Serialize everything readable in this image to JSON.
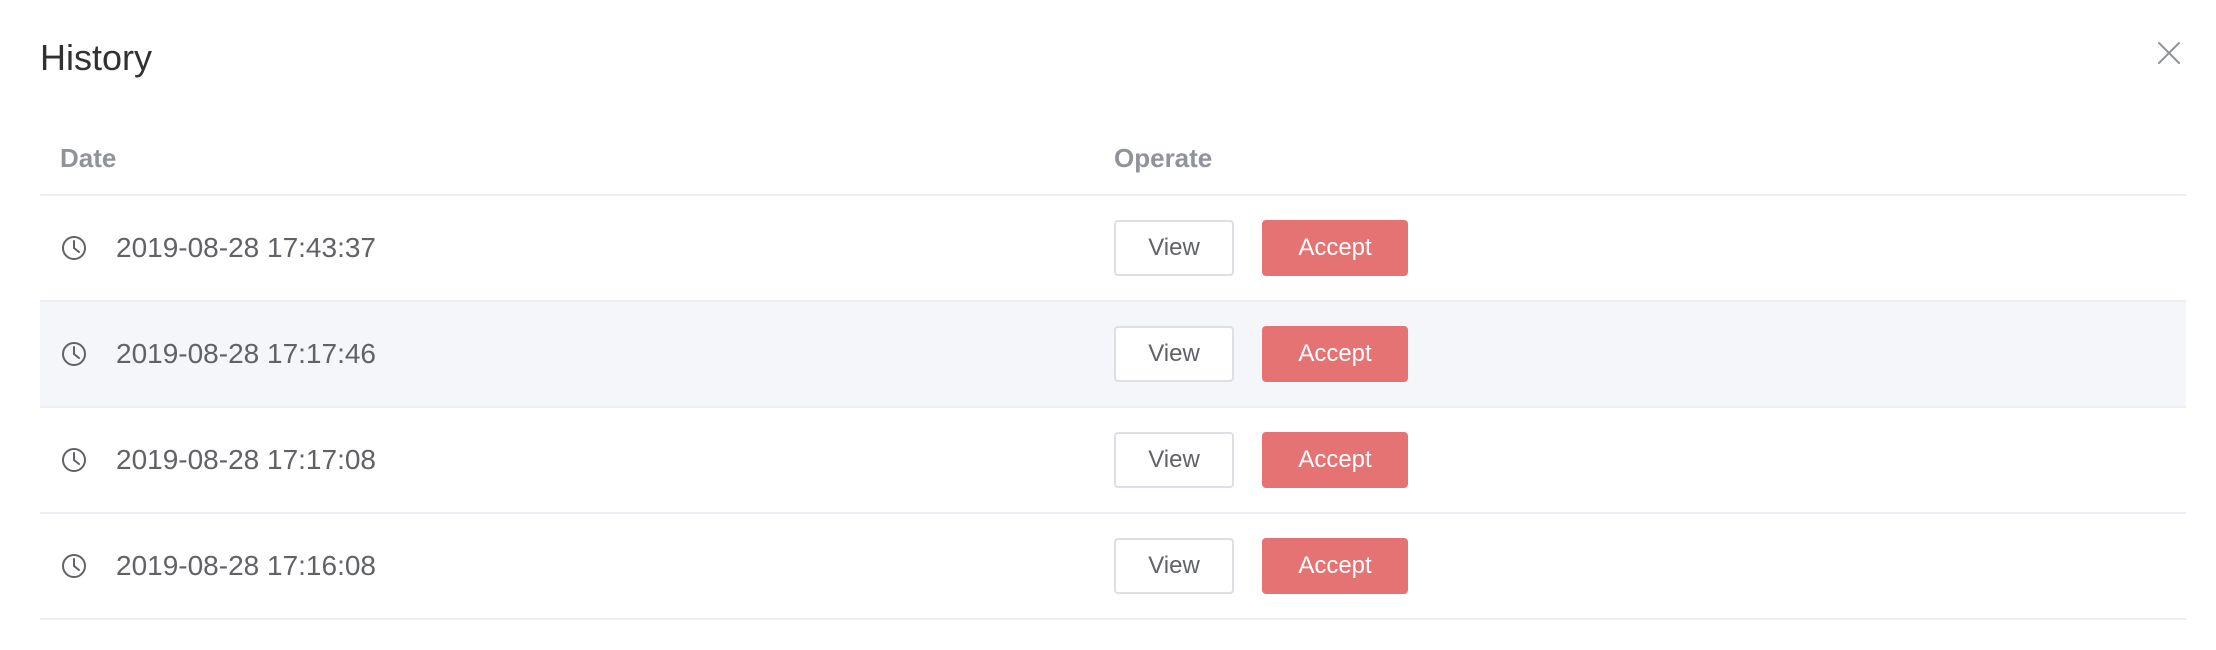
{
  "dialog": {
    "title": "History",
    "close_icon": "close-icon"
  },
  "table": {
    "columns": [
      "Date",
      "Operate"
    ],
    "rows": [
      {
        "date": "2019-08-28 17:43:37",
        "view_label": "View",
        "accept_label": "Accept"
      },
      {
        "date": "2019-08-28 17:17:46",
        "view_label": "View",
        "accept_label": "Accept"
      },
      {
        "date": "2019-08-28 17:17:08",
        "view_label": "View",
        "accept_label": "Accept"
      },
      {
        "date": "2019-08-28 17:16:08",
        "view_label": "View",
        "accept_label": "Accept"
      }
    ],
    "row_icon": "clock-icon"
  },
  "colors": {
    "accept": "#e57373",
    "stripe": "#f5f6fa",
    "header_text": "#909399"
  }
}
